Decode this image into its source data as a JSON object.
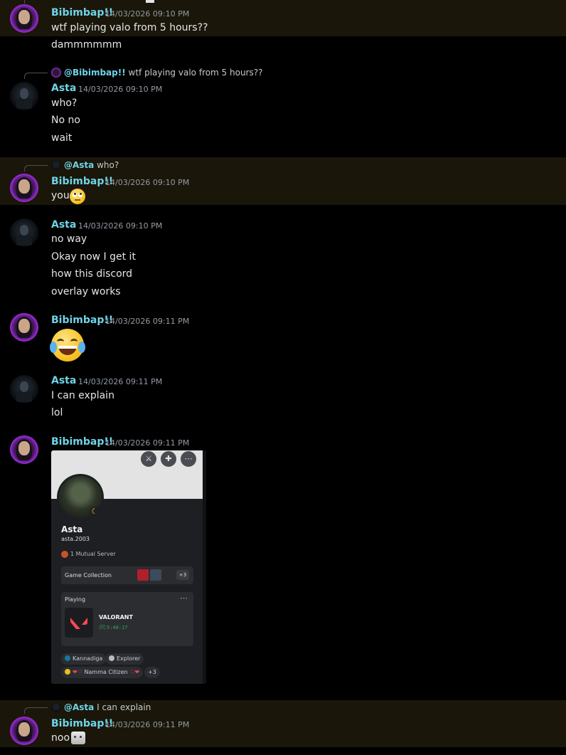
{
  "messages": [
    {
      "author": "Bibimbap!!",
      "timestamp": "14/03/2026 09:10 PM",
      "lines": [
        "wtf playing valo from 5 hours??",
        "dammmmmm"
      ]
    },
    {
      "reply": {
        "mention": "@Bibimbap!!",
        "text": "wtf playing valo from 5 hours??"
      },
      "author": "Asta",
      "timestamp": "14/03/2026 09:10 PM",
      "lines": [
        "who?",
        "No no",
        "wait"
      ]
    },
    {
      "reply": {
        "mention": "@Asta",
        "text": "who?"
      },
      "author": "Bibimbap!!",
      "timestamp": "14/03/2026 09:10 PM",
      "lines": [
        "you"
      ],
      "emoji": "face-with-rolling-eyes"
    },
    {
      "author": "Asta",
      "timestamp": "14/03/2026 09:10 PM",
      "lines": [
        "no way",
        "Okay now I get it",
        "how this discord",
        "overlay works"
      ]
    },
    {
      "author": "Bibimbap!!",
      "timestamp": "14/03/2026 09:11 PM",
      "emoji": "face-with-tears-of-joy"
    },
    {
      "author": "Asta",
      "timestamp": "14/03/2026 09:11 PM",
      "lines": [
        "I can explain",
        "lol"
      ]
    },
    {
      "author": "Bibimbap!!",
      "timestamp": "14/03/2026 09:11 PM",
      "attachment": {
        "profile_name": "Asta",
        "username": "asta.2003",
        "mutual": "1 Mutual Server",
        "game_collection": "Game Collection",
        "game_collection_more": "+3",
        "playing_label": "Playing",
        "game": "VALORANT",
        "elapsed": "5:40:17",
        "roles": [
          "Kannadiga",
          "Explorer",
          "Namma Citizen"
        ],
        "roles_more": "+3",
        "colors": {
          "kannadiga": "#0f7a9c",
          "explorer": "#b9bbbe",
          "namma": "#e8c21a"
        }
      }
    },
    {
      "reply": {
        "mention": "@Asta",
        "text": "I can explain"
      },
      "author": "Bibimbap!!",
      "timestamp": "14/03/2026 09:11 PM",
      "lines": [
        "noo"
      ],
      "emoji": "cat-sticker"
    }
  ],
  "colors": {
    "username": "#6fd4e8",
    "background": "#000000",
    "highlight": "#1a1609"
  }
}
